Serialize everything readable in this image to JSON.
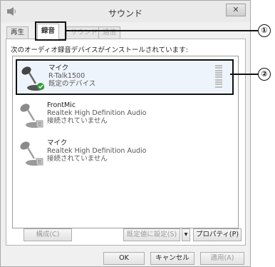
{
  "window": {
    "title": "サウンド",
    "close_glyph": "✕",
    "app_icon": "speaker-icon"
  },
  "tabs": [
    {
      "label": "再生",
      "active": false
    },
    {
      "label": "録音",
      "active": true
    },
    {
      "label": "サウンド",
      "active": false
    },
    {
      "label": "通信",
      "active": false
    }
  ],
  "instruction": "次のオーディオ録音デバイスがインストールされています:",
  "devices": [
    {
      "name": "マイク",
      "detail": "R-Talk1500",
      "status": "既定のデバイス",
      "selected": true,
      "icon": "microphone-icon"
    },
    {
      "name": "FrontMic",
      "detail": "Realtek High Definition Audio",
      "status": "接続されていません",
      "selected": false,
      "icon": "microphone-icon"
    },
    {
      "name": "マイク",
      "detail": "Realtek High Definition Audio",
      "status": "接続されていません",
      "selected": false,
      "icon": "microphone-icon"
    }
  ],
  "buttons": {
    "configure": "構成(C)",
    "set_default": "既定値に設定(S)",
    "set_default_arrow": "▾",
    "properties": "プロパティ(P)",
    "ok": "OK",
    "cancel": "キャンセル",
    "apply": "適用(A)"
  },
  "annotations": [
    "①",
    "②"
  ]
}
